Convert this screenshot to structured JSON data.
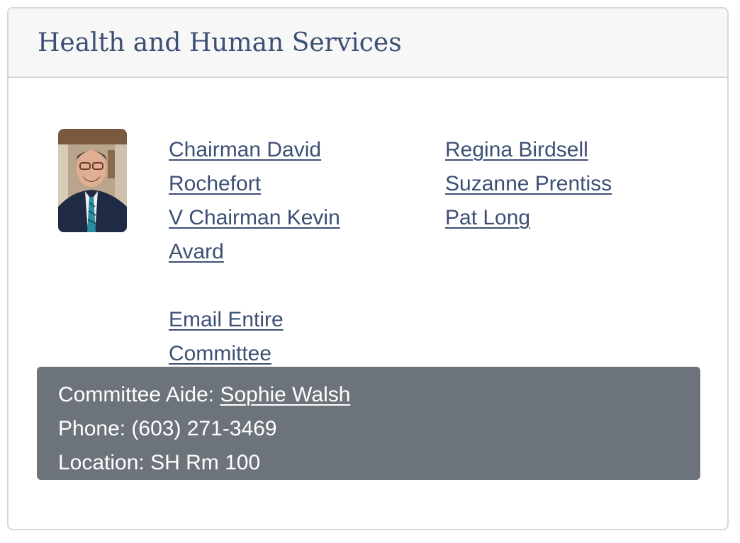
{
  "committee": {
    "title": "Health and Human Services"
  },
  "members_left": {
    "chairman": "Chairman David Rochefort",
    "vice_chairman": "V Chairman Kevin Avard",
    "email_all": "Email Entire Committee"
  },
  "members_right": [
    "Regina Birdsell",
    "Suzanne Prentiss",
    "Pat Long"
  ],
  "aide": {
    "aide_label": "Committee Aide: ",
    "aide_name": "Sophie Walsh",
    "phone_label": "Phone: ",
    "phone": "(603) 271-3469",
    "location_label": "Location: ",
    "location": "SH Rm 100"
  },
  "colors": {
    "link": "#3d4f74",
    "aide_background": "#6d737b",
    "header_background": "#f7f7f7"
  },
  "icons": {
    "photo": "chairman-photo"
  }
}
